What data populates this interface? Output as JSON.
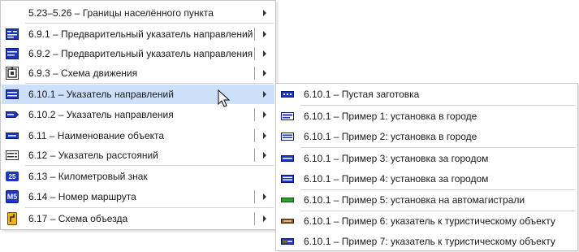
{
  "menu": {
    "items": [
      {
        "label": "5.23–5.26 – Границы населённого пункта"
      },
      {
        "label": "6.9.1 – Предварительный указатель направлений"
      },
      {
        "label": "6.9.2 – Предварительный указатель направления"
      },
      {
        "label": "6.9.3 – Схема движения"
      },
      {
        "label": "6.10.1 – Указатель направлений"
      },
      {
        "label": "6.10.2 – Указатель направления"
      },
      {
        "label": "6.11 – Наименование объекта"
      },
      {
        "label": "6.12 – Указатель расстояний"
      },
      {
        "label": "6.13 – Километровый знак",
        "icon_text": "25"
      },
      {
        "label": "6.14 – Номер маршрута",
        "icon_text": "M5"
      },
      {
        "label": "6.17 – Схема объезда"
      }
    ]
  },
  "submenu": {
    "items": [
      {
        "label": "6.10.1 – Пустая заготовка"
      },
      {
        "label": "6.10.1 – Пример 1: установка в городе"
      },
      {
        "label": "6.10.1 – Пример 2: установка в городе"
      },
      {
        "label": "6.10.1 – Пример 3: установка за городом"
      },
      {
        "label": "6.10.1 – Пример 4: установка за городом"
      },
      {
        "label": "6.10.1 – Пример 5: установка на автомагистрали"
      },
      {
        "label": "6.10.1 – Пример 6: указатель к туристическому объекту"
      },
      {
        "label": "6.10.1 – Пример 7: указатель к туристическому объекту"
      }
    ]
  },
  "colors": {
    "highlight": "#cde0fa",
    "sign_blue": "#1a35c8",
    "sign_green": "#2fa02f",
    "sign_brown": "#8a5a1e",
    "sign_yellow": "#f2b21c"
  }
}
